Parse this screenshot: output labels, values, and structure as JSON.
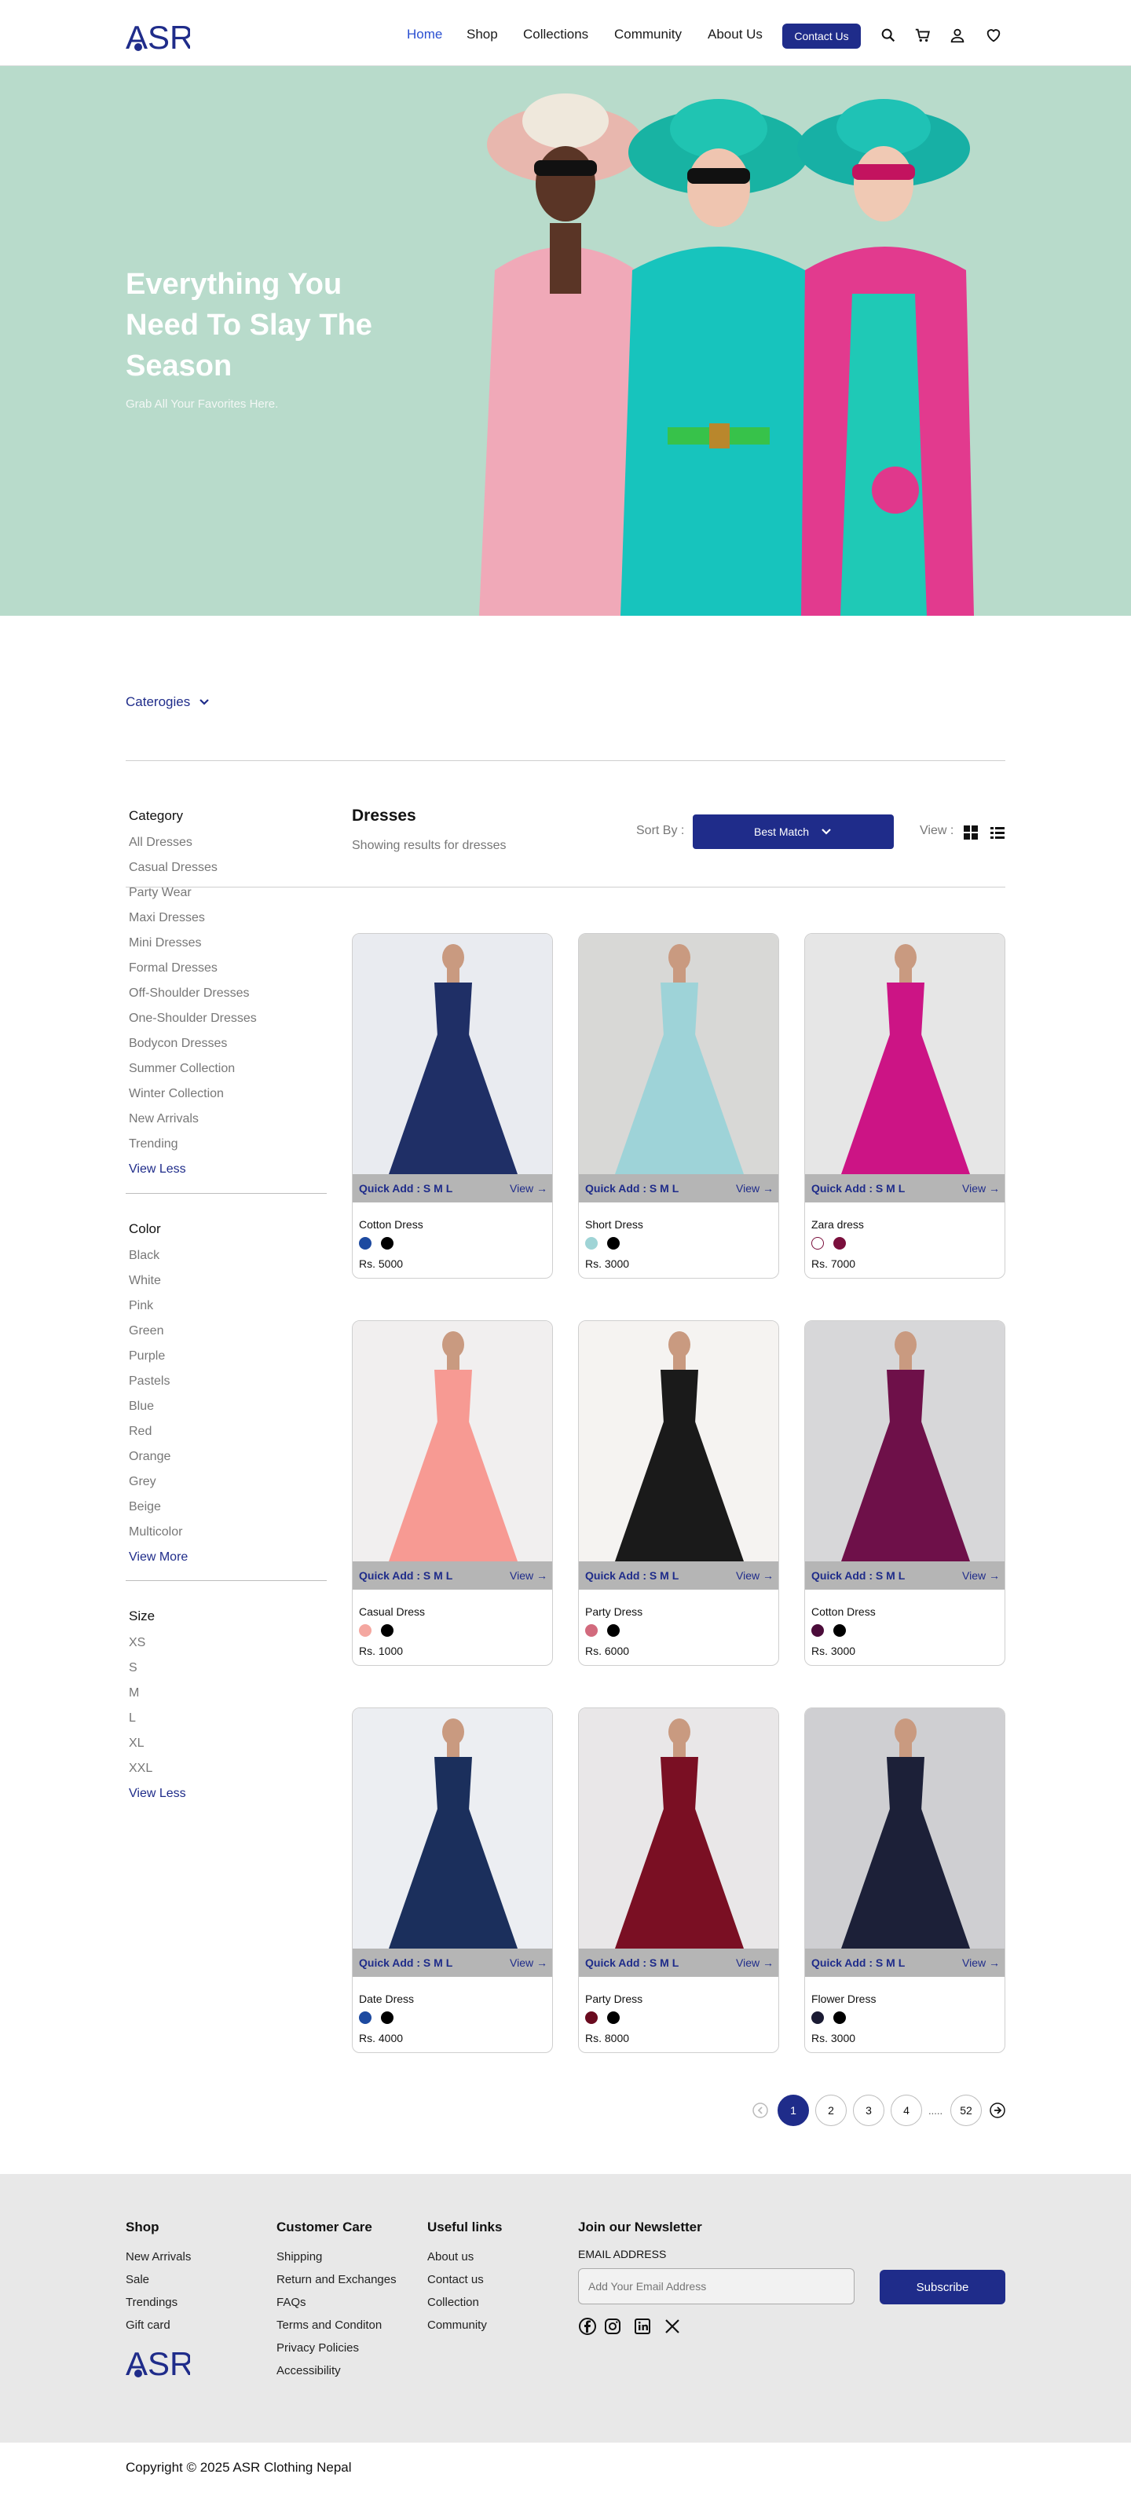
{
  "header": {
    "logo_text": "ASR",
    "nav": [
      "Home",
      "Shop",
      "Collections",
      "Community",
      "About Us"
    ],
    "active_nav": "Home",
    "contact_label": "Contact Us",
    "icons": [
      "search-icon",
      "cart-icon",
      "user-icon",
      "heart-icon"
    ]
  },
  "hero": {
    "title": "Everything You Need To Slay The Season",
    "subtitle": "Grab All Your Favorites Here."
  },
  "categories_toggle": "Caterogies",
  "sidebar": {
    "category": {
      "heading": "Category",
      "items": [
        "All Dresses",
        "Casual Dresses",
        "Party Wear",
        "Maxi Dresses",
        "Mini Dresses",
        "Formal Dresses",
        "Off-Shoulder Dresses",
        "One-Shoulder Dresses",
        "Bodycon Dresses",
        "Summer Collection",
        "Winter Collection",
        "New Arrivals",
        "Trending"
      ],
      "toggle": "View Less"
    },
    "color": {
      "heading": "Color",
      "items": [
        "Black",
        "White",
        "Pink",
        "Green",
        "Purple",
        "Pastels",
        "Blue",
        "Red",
        "Orange",
        "Grey",
        "Beige",
        "Multicolor"
      ],
      "toggle": "View More"
    },
    "size": {
      "heading": "Size",
      "items": [
        "XS",
        "S",
        "M",
        "L",
        "XL",
        "XXL"
      ],
      "toggle": "View Less"
    }
  },
  "main": {
    "title": "Dresses",
    "subtitle": "Showing results for dresses",
    "sort_label": "Sort By :",
    "sort_value": "Best Match",
    "view_label": "View :"
  },
  "quick_add_label": "Quick Add : S  M  L",
  "view_link": "View",
  "products": [
    {
      "name": "Cotton Dress",
      "price": "Rs. 5000",
      "colors": [
        "#1d4aa0",
        "#000000"
      ],
      "bg": "#e9ebf0",
      "dress": "#1f2f66"
    },
    {
      "name": "Short Dress",
      "price": "Rs. 3000",
      "colors": [
        "#9fd4d6",
        "#000000"
      ],
      "bg": "#d8d8d6",
      "dress": "#9ed3d8"
    },
    {
      "name": "Zara dress",
      "price": "Rs. 7000",
      "colors": [
        "#ffffff",
        "#7a0f3c"
      ],
      "bg": "#e6e6e6",
      "dress": "#cc1485"
    },
    {
      "name": "Casual Dress",
      "price": "Rs. 1000",
      "colors": [
        "#f4a7a0",
        "#000000"
      ],
      "bg": "#f1efef",
      "dress": "#f79a93"
    },
    {
      "name": "Party Dress",
      "price": "Rs. 6000",
      "colors": [
        "#d26a7d",
        "#000000"
      ],
      "bg": "#f5f3f1",
      "dress": "#1a1a1a"
    },
    {
      "name": "Cotton Dress",
      "price": "Rs. 3000",
      "colors": [
        "#4b0c3a",
        "#000000"
      ],
      "bg": "#d7d7d9",
      "dress": "#6e1049"
    },
    {
      "name": "Date Dress",
      "price": "Rs. 4000",
      "colors": [
        "#1d4aa0",
        "#000000"
      ],
      "bg": "#eceef2",
      "dress": "#1b2f5c"
    },
    {
      "name": "Party Dress",
      "price": "Rs. 8000",
      "colors": [
        "#6a0b1f",
        "#000000"
      ],
      "bg": "#e9e7e8",
      "dress": "#7a0f23"
    },
    {
      "name": "Flower Dress",
      "price": "Rs. 3000",
      "colors": [
        "#1a1b33",
        "#000000"
      ],
      "bg": "#cfcfd2",
      "dress": "#1c2038"
    }
  ],
  "pagination": {
    "pages": [
      "1",
      "2",
      "3",
      "4",
      "52"
    ],
    "ellipsis": ".....",
    "current": "1"
  },
  "footer": {
    "shop": {
      "heading": "Shop",
      "links": [
        "New Arrivals",
        "Sale",
        "Trendings",
        "Gift card"
      ]
    },
    "care": {
      "heading": "Customer Care",
      "links": [
        "Shipping",
        "Return and Exchanges",
        "FAQs",
        "Terms and Conditon",
        "Privacy Policies",
        "Accessibility"
      ]
    },
    "useful": {
      "heading": "Useful links",
      "links": [
        "About us",
        "Contact us",
        "Collection",
        "Community"
      ]
    },
    "newsletter": {
      "heading": "Join our Newsletter",
      "email_label": "EMAIL ADDRESS",
      "placeholder": "Add Your Email Address",
      "button": "Subscribe"
    },
    "social_icons": [
      "facebook-icon",
      "instagram-icon",
      "linkedin-icon",
      "x-icon"
    ],
    "logo_text": "ASR"
  },
  "copyright": "Copyright © 2025 ASR Clothing Nepal",
  "colors": {
    "brand": "#1f2c8a",
    "hero_bg": "#b8dbcb",
    "footer_bg": "#e8e8e8",
    "active_nav": "#2a4fd1"
  }
}
